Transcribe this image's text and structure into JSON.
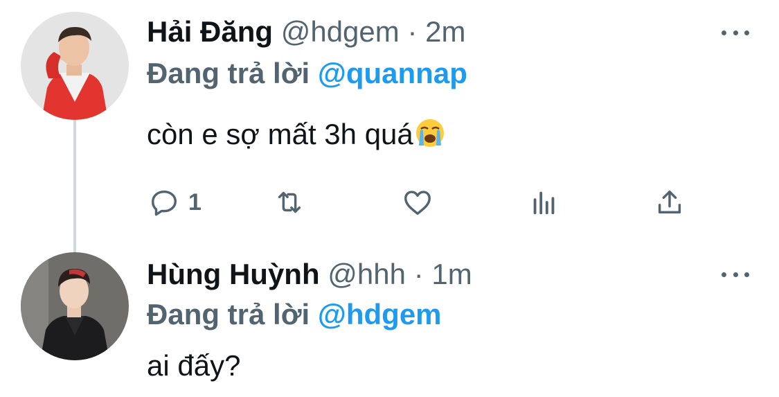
{
  "tweets": [
    {
      "display_name": "Hải Đăng",
      "handle": "@hdgem",
      "separator": "·",
      "time": "2m",
      "reply_prefix": "Đang trả lời",
      "reply_to": "@quannap",
      "text": "còn e sợ mất 3h quá",
      "emoji": "loudly-crying-face",
      "reply_count": "1",
      "avatar": "avatar-man-red-suit"
    },
    {
      "display_name": "Hùng Huỳnh",
      "handle": "@hhh",
      "separator": "·",
      "time": "1m",
      "reply_prefix": "Đang trả lời",
      "reply_to": "@hdgem",
      "text": "ai đấy?",
      "avatar": "avatar-man-black-outfit"
    }
  ],
  "icons": {
    "reply": "reply-icon",
    "retweet": "retweet-icon",
    "like": "heart-icon",
    "analytics": "analytics-icon",
    "share": "share-icon",
    "more": "more-icon"
  },
  "colors": {
    "mention": "#1d9bf0",
    "secondary_text": "#536471",
    "primary_text": "#0f1419",
    "thread_line": "#cfd9de"
  }
}
